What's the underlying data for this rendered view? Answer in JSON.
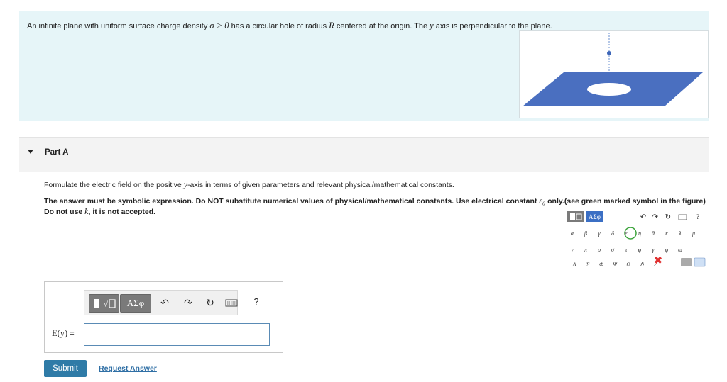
{
  "problem": {
    "text_1": "An infinite plane with uniform surface charge density ",
    "sigma_expr": "σ > 0",
    "text_2": " has a circular hole of radius ",
    "radius_symbol": "R",
    "text_3": " centered at the origin. The ",
    "y_symbol": "y",
    "text_4": " axis is perpendicular to the plane."
  },
  "part": {
    "title": "Part A"
  },
  "question": {
    "text_1": "Formulate the electric field on the positive ",
    "y_symbol": "y",
    "text_2": "-axis in terms of given parameters and relevant physical/mathematical constants."
  },
  "instruction": {
    "text_1": "The answer must be symbolic expression. Do NOT substitute numerical values of physical/mathematical constants. Use electrical constant ",
    "epsilon_symbol": "ε₀",
    "text_2": " only.(see green marked symbol in the figure) Do not use ",
    "k_symbol": "k",
    "text_3": ", it is not accepted."
  },
  "keyboard_figure": {
    "tab_symbols": "ΑΣφ",
    "help": "?",
    "row1": [
      "α",
      "β",
      "γ",
      "δ",
      "ε",
      "η",
      "θ",
      "κ",
      "λ",
      "μ"
    ],
    "row2": [
      "ν",
      "π",
      "ρ",
      "σ",
      "τ",
      "φ",
      "γ",
      "ψ",
      "ω"
    ],
    "row3": [
      "Δ",
      "Σ",
      "Φ",
      "Ψ",
      "Ω",
      "ℏ",
      "ε"
    ],
    "colors": {
      "green_circle": "#3aa33a",
      "red_x": "#e03030",
      "tab_blue": "#3b6fc4"
    }
  },
  "toolbar": {
    "symbols_label": "ΑΣφ",
    "undo_icon": "↶",
    "redo_icon": "↷",
    "reset_icon": "↻",
    "keyboard_icon": "keyboard-icon",
    "help_label": "?"
  },
  "answer": {
    "label_var": "E(y)",
    "label_eq": " =",
    "value": ""
  },
  "actions": {
    "submit_label": "Submit",
    "request_label": "Request Answer"
  },
  "colors": {
    "problem_bg": "#e6f5f8",
    "plane_blue": "#4a6fc0",
    "submit_bg": "#2f7ba7",
    "link": "#2f6fa5"
  }
}
